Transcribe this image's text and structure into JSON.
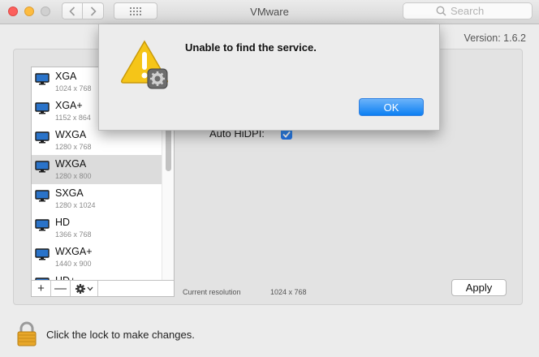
{
  "window": {
    "title": "VMware",
    "search_placeholder": "Search"
  },
  "version_text": "Version: 1.6.2",
  "resolutions": [
    {
      "name": "XGA",
      "res": "1024 x 768"
    },
    {
      "name": "XGA+",
      "res": "1152 x 864"
    },
    {
      "name": "WXGA",
      "res": "1280 x 768"
    },
    {
      "name": "WXGA",
      "res": "1280 x 800",
      "selected": true
    },
    {
      "name": "SXGA",
      "res": "1280 x 1024"
    },
    {
      "name": "HD",
      "res": "1366 x 768"
    },
    {
      "name": "WXGA+",
      "res": "1440 x 900"
    },
    {
      "name": "HD+",
      "res": ""
    }
  ],
  "list_footer": {
    "add": "+",
    "remove": "—"
  },
  "settings": {
    "auto_hidpi_label": "Auto HiDPI:",
    "auto_hidpi_checked": true,
    "current_resolution_label": "Current resolution",
    "current_resolution_value": "1024 x 768",
    "apply_label": "Apply"
  },
  "lock": {
    "text": "Click the lock to make changes."
  },
  "alert": {
    "message": "Unable to find the service.",
    "ok_label": "OK"
  },
  "colors": {
    "accent": "#2072e5",
    "ok_button": "#1a86f4",
    "close": "#fc605c",
    "minimize": "#fdbc40"
  }
}
